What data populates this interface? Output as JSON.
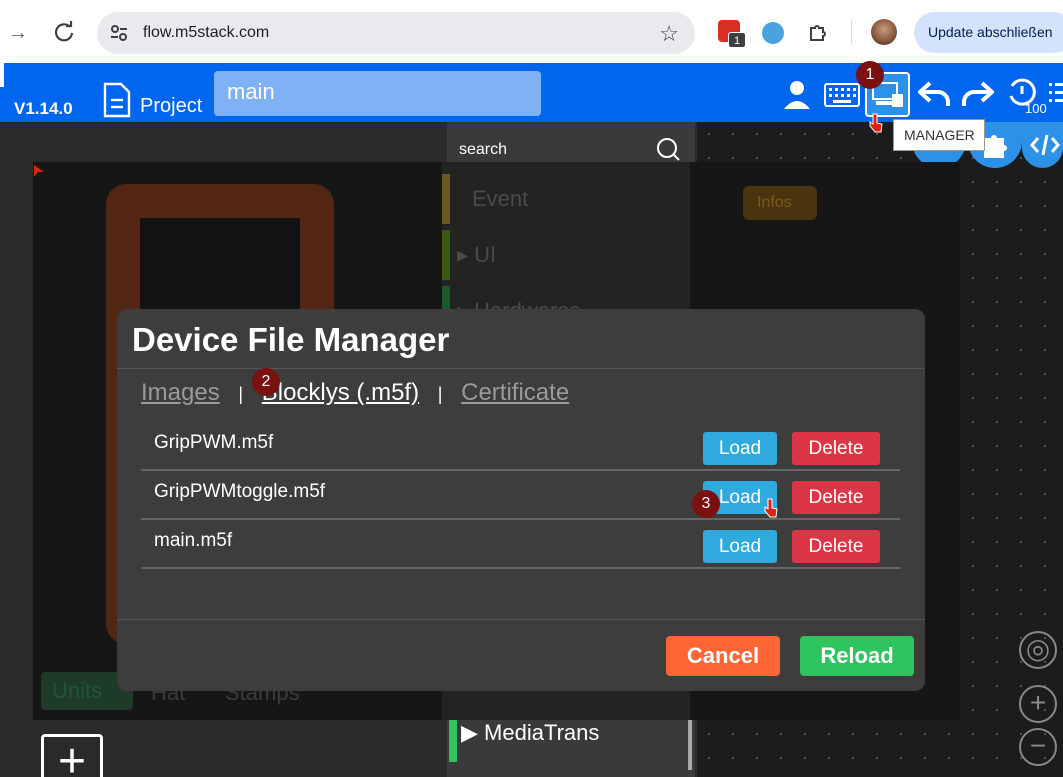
{
  "browser": {
    "url": "flow.m5stack.com",
    "ext_badge": "1",
    "update_label": "Update abschließen"
  },
  "app": {
    "version": "V1.14.0",
    "project_label": "Project",
    "file_name": "main",
    "tooltip": "MANAGER",
    "zoom_counter": "100"
  },
  "toolbox": {
    "search_placeholder": "search",
    "items": [
      "Event",
      "UI",
      "Hardwares"
    ],
    "media_trans": "MediaTrans"
  },
  "side_tabs": [
    "Units",
    "Hat",
    "Stamps"
  ],
  "info_label": "Infos",
  "modal": {
    "title": "Device File Manager",
    "tabs": [
      {
        "label": "Images",
        "active": false
      },
      {
        "label": "Blocklys (.m5f)",
        "active": true
      },
      {
        "label": "Certificate",
        "active": false
      }
    ],
    "tab_separator": "|",
    "files": [
      {
        "name": "GripPWM.m5f",
        "load": "Load",
        "delete": "Delete"
      },
      {
        "name": "GripPWMtoggle.m5f",
        "load": "Load",
        "delete": "Delete"
      },
      {
        "name": "main.m5f",
        "load": "Load",
        "delete": "Delete"
      }
    ],
    "cancel_label": "Cancel",
    "reload_label": "Reload"
  },
  "markers": [
    "1",
    "2",
    "3"
  ],
  "colors": {
    "header_blue": "#0066ee",
    "load_blue": "#30a9de",
    "delete_red": "#dc3545",
    "cancel_orange": "#ff6633",
    "reload_green": "#2ec45e",
    "marker_red": "#7a1010"
  }
}
